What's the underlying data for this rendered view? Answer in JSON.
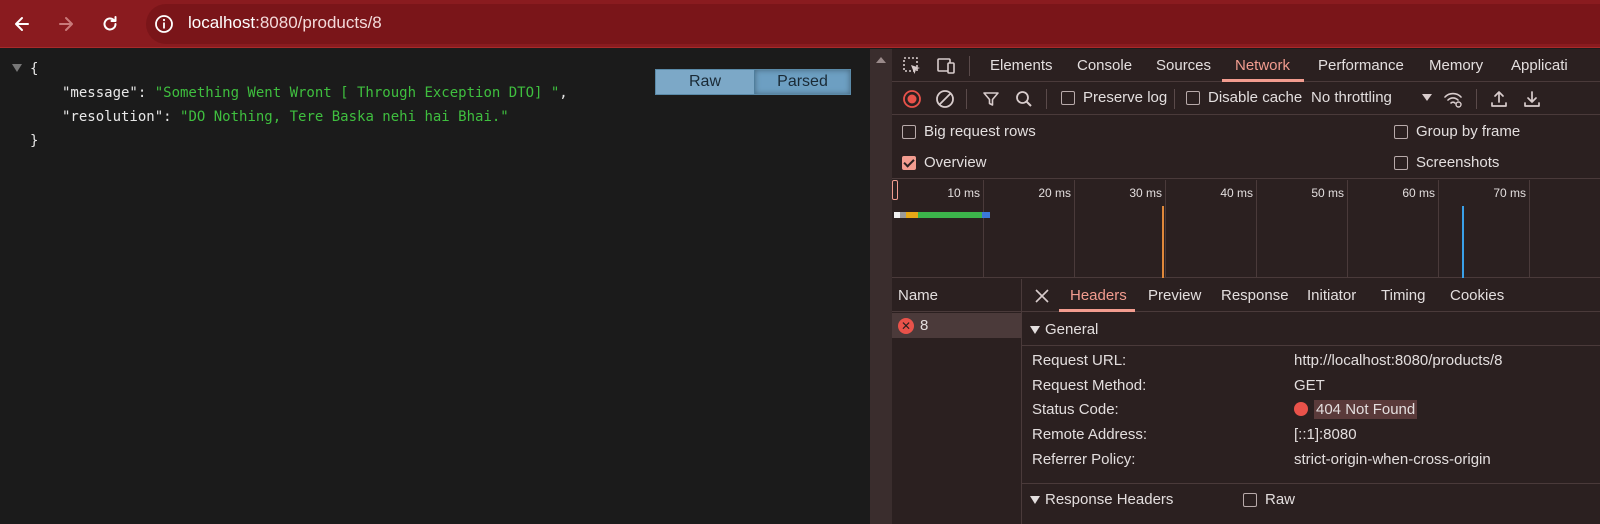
{
  "browser": {
    "url_host": "localhost",
    "url_rest": ":8080/products/8"
  },
  "json_view": {
    "open_brace": "{",
    "close_brace": "}",
    "entries": [
      {
        "key": "\"message\"",
        "value": "\"Something Went Wront [ Through Exception DTO] \"",
        "trail": ","
      },
      {
        "key": "\"resolution\"",
        "value": "\"DO Nothing, Tere Baska nehi hai Bhai.\"",
        "trail": ""
      }
    ],
    "raw_label": "Raw",
    "parsed_label": "Parsed"
  },
  "devtools": {
    "tabs": [
      "Elements",
      "Console",
      "Sources",
      "Network",
      "Performance",
      "Memory",
      "Applicati"
    ],
    "active_tab": "Network",
    "toolbar": {
      "preserve_log": "Preserve log",
      "disable_cache": "Disable cache",
      "throttling": "No throttling"
    },
    "settings": {
      "big_request_rows": "Big request rows",
      "group_by_frame": "Group by frame",
      "overview": "Overview",
      "screenshots": "Screenshots"
    },
    "timeline_labels": [
      "10 ms",
      "20 ms",
      "30 ms",
      "40 ms",
      "50 ms",
      "60 ms",
      "70 ms"
    ],
    "request_list": {
      "header": "Name",
      "rows": [
        {
          "name": "8",
          "status_icon": "error-icon"
        }
      ]
    },
    "detail_tabs": [
      "Headers",
      "Preview",
      "Response",
      "Initiator",
      "Timing",
      "Cookies"
    ],
    "active_detail_tab": "Headers",
    "general": {
      "title": "General",
      "rows": [
        {
          "key": "Request URL:",
          "value": "http://localhost:8080/products/8"
        },
        {
          "key": "Request Method:",
          "value": "GET"
        },
        {
          "key": "Status Code:",
          "value": "404 Not Found"
        },
        {
          "key": "Remote Address:",
          "value": "[::1]:8080"
        },
        {
          "key": "Referrer Policy:",
          "value": "strict-origin-when-cross-origin"
        }
      ]
    },
    "response_headers": {
      "title": "Response Headers",
      "raw_label": "Raw"
    }
  },
  "colors": {
    "accent": "#f29c8f",
    "error": "#e9524a",
    "json_string": "#3fbf3f",
    "titlebar": "#8a1b1f"
  }
}
